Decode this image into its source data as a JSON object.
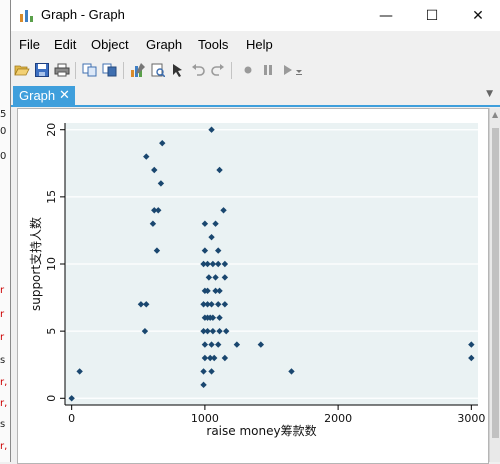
{
  "window": {
    "title": "Graph - Graph",
    "controls": {
      "minimize": "—",
      "maximize": "☐",
      "close": "✕"
    }
  },
  "menu": [
    "File",
    "Edit",
    "Object",
    "Graph",
    "Tools",
    "Help"
  ],
  "toolbar": {
    "icons": [
      "open-icon",
      "save-icon",
      "print-icon",
      "copy-icon",
      "copy-format-icon",
      "graph-editor-icon",
      "preview-icon",
      "pointer-icon",
      "undo-icon",
      "redo-icon",
      "record-icon",
      "pause-icon",
      "play-icon",
      "dropdown-icon"
    ]
  },
  "tab": {
    "label": "Graph",
    "close": "✕"
  },
  "background_window": {
    "chars": [
      "5",
      "0",
      "0",
      "r",
      "r",
      "r",
      "s",
      "r,",
      "r,",
      "s",
      "r,",
      "r,",
      "s"
    ]
  },
  "chart_data": {
    "type": "scatter",
    "title": "",
    "xlabel": "raise money筹款数",
    "ylabel": "support支持人数",
    "xlim": [
      -50,
      3050
    ],
    "ylim": [
      -0.5,
      20.5
    ],
    "xticks": [
      "0",
      "1000",
      "2000",
      "3000"
    ],
    "yticks": [
      "0",
      "5",
      "10",
      "15",
      "20"
    ],
    "grid": true,
    "marker_color": "#1a476f",
    "points": [
      {
        "x": 0,
        "y": 0
      },
      {
        "x": 60,
        "y": 2
      },
      {
        "x": 520,
        "y": 7
      },
      {
        "x": 560,
        "y": 7
      },
      {
        "x": 550,
        "y": 5
      },
      {
        "x": 560,
        "y": 18
      },
      {
        "x": 620,
        "y": 17
      },
      {
        "x": 680,
        "y": 19
      },
      {
        "x": 670,
        "y": 16
      },
      {
        "x": 620,
        "y": 14
      },
      {
        "x": 650,
        "y": 14
      },
      {
        "x": 610,
        "y": 13
      },
      {
        "x": 640,
        "y": 11
      },
      {
        "x": 1050,
        "y": 20
      },
      {
        "x": 1110,
        "y": 17
      },
      {
        "x": 1140,
        "y": 14
      },
      {
        "x": 1000,
        "y": 13
      },
      {
        "x": 1080,
        "y": 13
      },
      {
        "x": 1050,
        "y": 12
      },
      {
        "x": 1000,
        "y": 11
      },
      {
        "x": 1100,
        "y": 11
      },
      {
        "x": 990,
        "y": 10
      },
      {
        "x": 1020,
        "y": 10
      },
      {
        "x": 1060,
        "y": 10
      },
      {
        "x": 1100,
        "y": 10
      },
      {
        "x": 1150,
        "y": 10
      },
      {
        "x": 1030,
        "y": 9
      },
      {
        "x": 1080,
        "y": 9
      },
      {
        "x": 1150,
        "y": 9
      },
      {
        "x": 1000,
        "y": 8
      },
      {
        "x": 1020,
        "y": 8
      },
      {
        "x": 1080,
        "y": 8
      },
      {
        "x": 1110,
        "y": 8
      },
      {
        "x": 990,
        "y": 7
      },
      {
        "x": 1020,
        "y": 7
      },
      {
        "x": 1050,
        "y": 7
      },
      {
        "x": 1100,
        "y": 7
      },
      {
        "x": 1150,
        "y": 7
      },
      {
        "x": 1000,
        "y": 6
      },
      {
        "x": 1020,
        "y": 6
      },
      {
        "x": 1040,
        "y": 6
      },
      {
        "x": 1060,
        "y": 6
      },
      {
        "x": 1110,
        "y": 6
      },
      {
        "x": 990,
        "y": 5
      },
      {
        "x": 1020,
        "y": 5
      },
      {
        "x": 1060,
        "y": 5
      },
      {
        "x": 1110,
        "y": 5
      },
      {
        "x": 1160,
        "y": 5
      },
      {
        "x": 1000,
        "y": 4
      },
      {
        "x": 1050,
        "y": 4
      },
      {
        "x": 1100,
        "y": 4
      },
      {
        "x": 1240,
        "y": 4
      },
      {
        "x": 1420,
        "y": 4
      },
      {
        "x": 1000,
        "y": 3
      },
      {
        "x": 1040,
        "y": 3
      },
      {
        "x": 1070,
        "y": 3
      },
      {
        "x": 1150,
        "y": 3
      },
      {
        "x": 990,
        "y": 2
      },
      {
        "x": 1050,
        "y": 2
      },
      {
        "x": 1650,
        "y": 2
      },
      {
        "x": 990,
        "y": 1
      },
      {
        "x": 3000,
        "y": 4
      },
      {
        "x": 3000,
        "y": 3
      }
    ]
  }
}
